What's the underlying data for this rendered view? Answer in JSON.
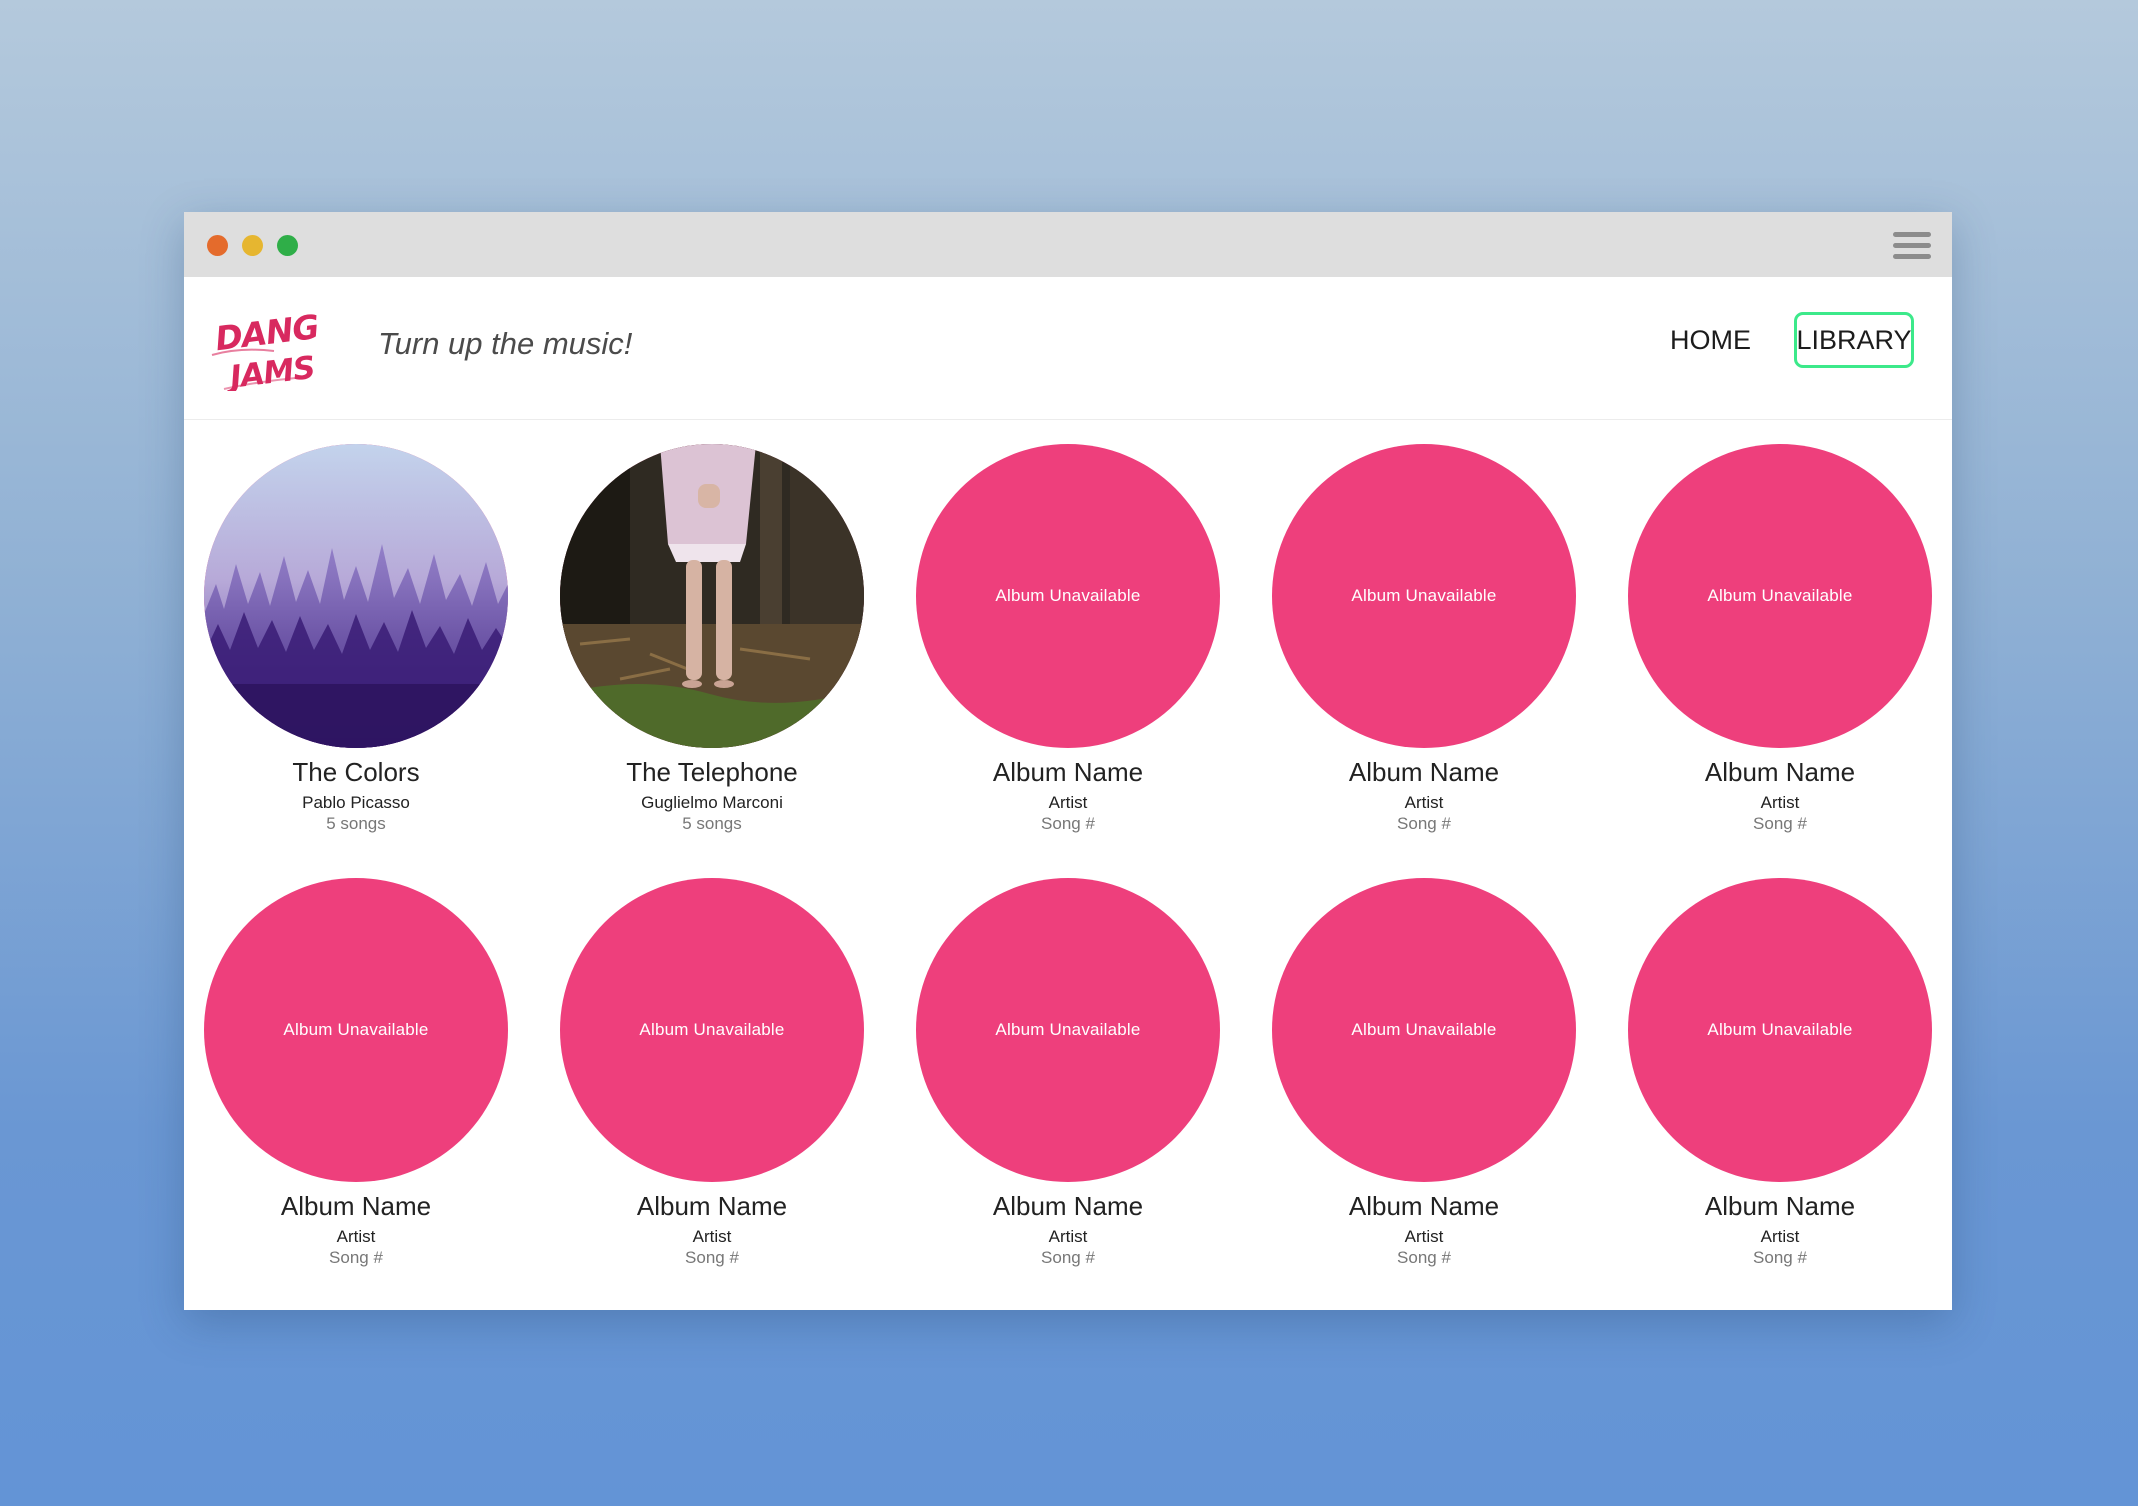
{
  "header": {
    "logo_text": [
      "DANG",
      "JAMS"
    ],
    "tagline": "Turn up the music!",
    "nav": {
      "home_label": "HOME",
      "library_label": "LIBRARY",
      "active_item": "LIBRARY"
    }
  },
  "albums": [
    {
      "title": "The Colors",
      "artist": "Pablo Picasso",
      "songs": "5 songs",
      "cover": "misty-purple-forest-image",
      "cover_text": ""
    },
    {
      "title": "The Telephone",
      "artist": "Guglielmo Marconi",
      "songs": "5 songs",
      "cover": "girl-in-forest-image",
      "cover_text": ""
    },
    {
      "title": "Album Name",
      "artist": "Artist",
      "songs": "Song #",
      "cover": "placeholder",
      "cover_text": "Album Unavailable"
    },
    {
      "title": "Album Name",
      "artist": "Artist",
      "songs": "Song #",
      "cover": "placeholder",
      "cover_text": "Album Unavailable"
    },
    {
      "title": "Album Name",
      "artist": "Artist",
      "songs": "Song #",
      "cover": "placeholder",
      "cover_text": "Album Unavailable"
    },
    {
      "title": "Album Name",
      "artist": "Artist",
      "songs": "Song #",
      "cover": "placeholder",
      "cover_text": "Album Unavailable"
    },
    {
      "title": "Album Name",
      "artist": "Artist",
      "songs": "Song #",
      "cover": "placeholder",
      "cover_text": "Album Unavailable"
    },
    {
      "title": "Album Name",
      "artist": "Artist",
      "songs": "Song #",
      "cover": "placeholder",
      "cover_text": "Album Unavailable"
    },
    {
      "title": "Album Name",
      "artist": "Artist",
      "songs": "Song #",
      "cover": "placeholder",
      "cover_text": "Album Unavailable"
    },
    {
      "title": "Album Name",
      "artist": "Artist",
      "songs": "Song #",
      "cover": "placeholder",
      "cover_text": "Album Unavailable"
    }
  ],
  "colors": {
    "brand_pink": "#ee3f7c",
    "logo_pink": "#d8295f",
    "active_nav_border": "#3ce98a",
    "titlebar": "#dedede"
  },
  "icons": {
    "window_close": "red-dot",
    "window_minimize": "yellow-dot",
    "window_maximize": "green-dot",
    "menu": "hamburger-icon"
  }
}
